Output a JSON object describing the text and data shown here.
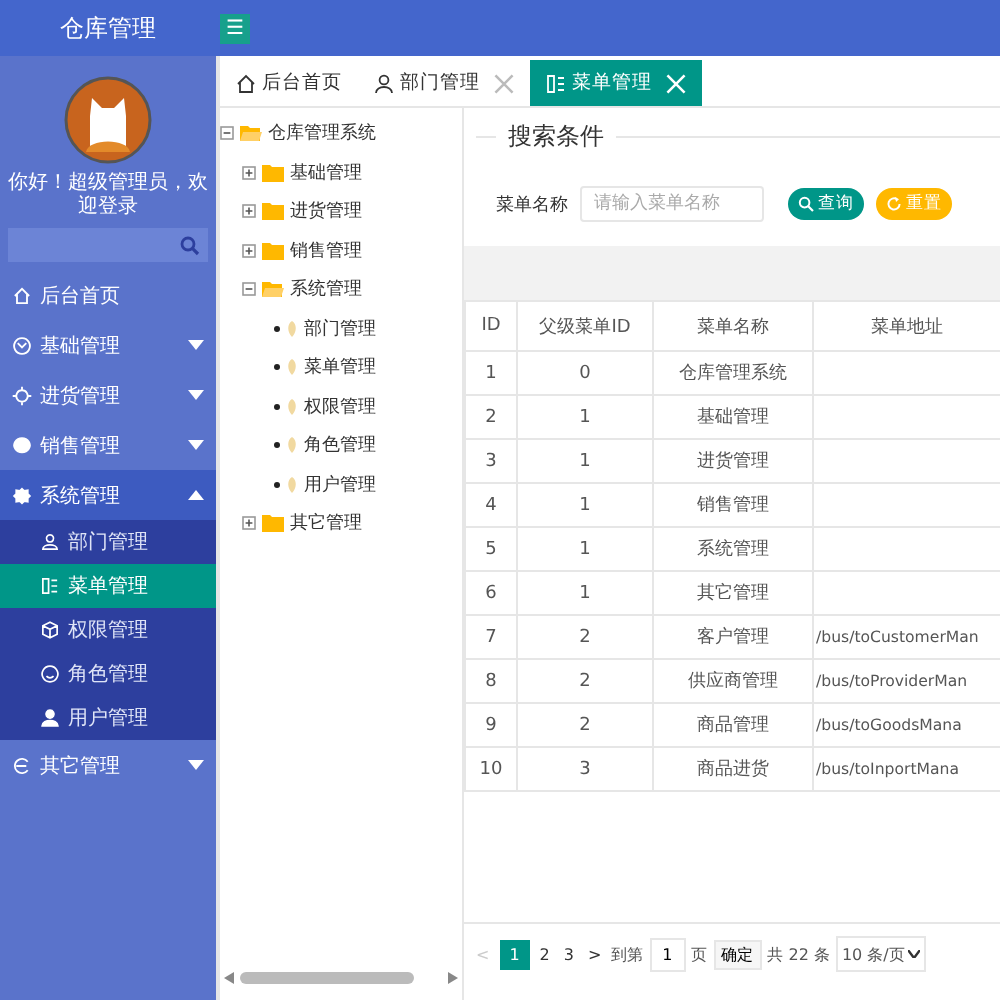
{
  "header": {
    "title": "仓库管理",
    "menu_toggle": "☰"
  },
  "sidebar": {
    "greeting": "你好！超级管理员，欢迎登录",
    "items": [
      {
        "kind": "link",
        "label": "后台首页",
        "expanded": false
      },
      {
        "kind": "group",
        "label": "基础管理",
        "expanded": false
      },
      {
        "kind": "group",
        "label": "进货管理",
        "expanded": false
      },
      {
        "kind": "group",
        "label": "销售管理",
        "expanded": false
      },
      {
        "kind": "group",
        "label": "系统管理",
        "expanded": true,
        "children": [
          {
            "label": "部门管理",
            "selected": false
          },
          {
            "label": "菜单管理",
            "selected": true
          },
          {
            "label": "权限管理",
            "selected": false
          },
          {
            "label": "角色管理",
            "selected": false
          },
          {
            "label": "用户管理",
            "selected": false
          }
        ]
      },
      {
        "kind": "group",
        "label": "其它管理",
        "expanded": false
      }
    ]
  },
  "tabs": [
    {
      "label": "后台首页",
      "selected": false,
      "closable": false
    },
    {
      "label": "部门管理",
      "selected": false,
      "closable": true
    },
    {
      "label": "菜单管理",
      "selected": true,
      "closable": true
    }
  ],
  "tree": [
    {
      "label": "仓库管理系统",
      "expanded": true,
      "children": [
        {
          "label": "基础管理",
          "expanded": false
        },
        {
          "label": "进货管理",
          "expanded": false
        },
        {
          "label": "销售管理",
          "expanded": false
        },
        {
          "label": "系统管理",
          "expanded": true,
          "children": [
            {
              "label": "部门管理"
            },
            {
              "label": "菜单管理"
            },
            {
              "label": "权限管理"
            },
            {
              "label": "角色管理"
            },
            {
              "label": "用户管理"
            }
          ]
        },
        {
          "label": "其它管理",
          "expanded": false
        }
      ]
    }
  ],
  "search": {
    "title": "搜索条件",
    "label": "菜单名称",
    "placeholder": "请输入菜单名称",
    "buttons": [
      {
        "kind": "search",
        "label": "查询"
      },
      {
        "kind": "reset",
        "label": "重置"
      }
    ]
  },
  "table": {
    "columns": [
      "ID",
      "父级菜单ID",
      "菜单名称",
      "菜单地址"
    ],
    "rows": [
      [
        "1",
        "0",
        "仓库管理系统",
        ""
      ],
      [
        "2",
        "1",
        "基础管理",
        ""
      ],
      [
        "3",
        "1",
        "进货管理",
        ""
      ],
      [
        "4",
        "1",
        "销售管理",
        ""
      ],
      [
        "5",
        "1",
        "系统管理",
        ""
      ],
      [
        "6",
        "1",
        "其它管理",
        ""
      ],
      [
        "7",
        "2",
        "客户管理",
        "/bus/toCustomerMan"
      ],
      [
        "8",
        "2",
        "供应商管理",
        "/bus/toProviderMan"
      ],
      [
        "9",
        "2",
        "商品管理",
        "/bus/toGoodsMana"
      ],
      [
        "10",
        "3",
        "商品进货",
        "/bus/toInportMana"
      ]
    ]
  },
  "pager": {
    "prev": "<",
    "pages": [
      {
        "label": "1",
        "selected": true
      },
      {
        "label": "2",
        "selected": false
      },
      {
        "label": "3",
        "selected": false
      }
    ],
    "next": ">",
    "goto_label": "到第",
    "goto_value": "1",
    "page_unit": "页",
    "confirm": "确定",
    "total": "共 22 条",
    "page_size": "10 条/页"
  }
}
